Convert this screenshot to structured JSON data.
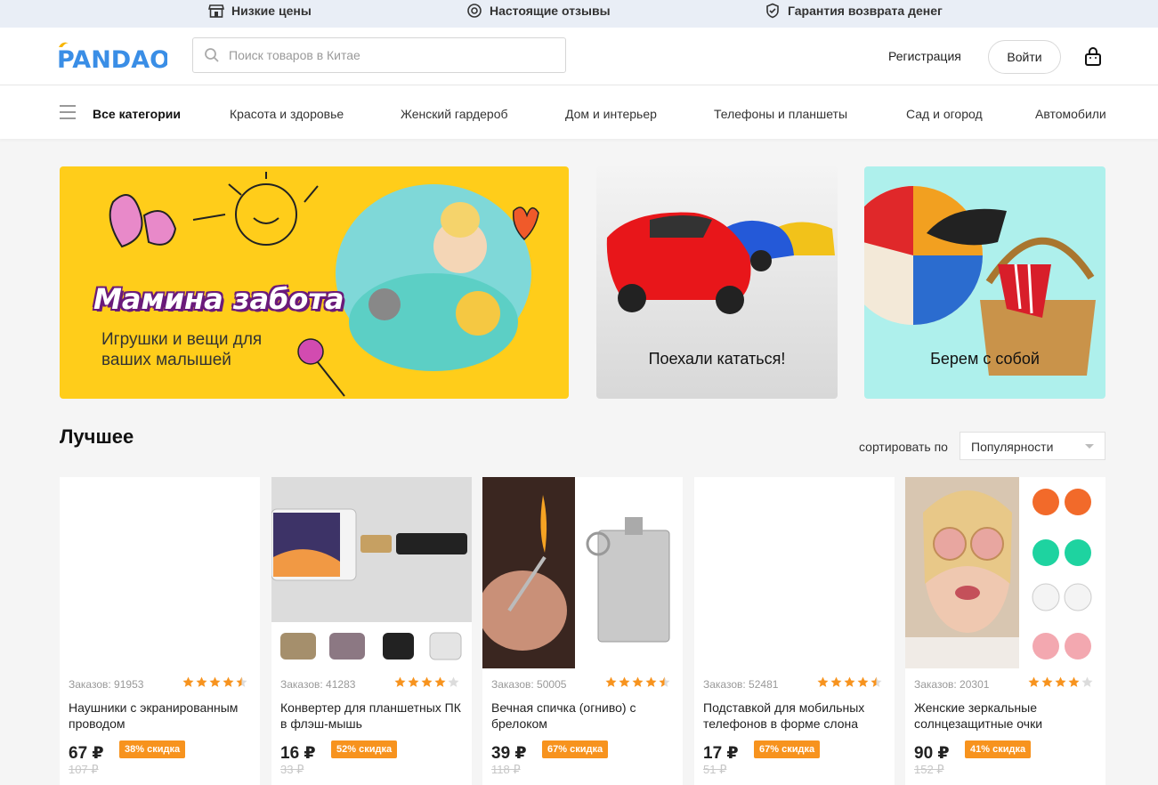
{
  "promo": {
    "items": [
      {
        "label": "Низкие цены",
        "icon": "shop-icon"
      },
      {
        "label": "Настоящие отзывы",
        "icon": "review-icon"
      },
      {
        "label": "Гарантия возврата денег",
        "icon": "shield-icon"
      }
    ]
  },
  "header": {
    "logo": "PANDAO",
    "search_placeholder": "Поиск товаров в Китае",
    "register": "Регистрация",
    "login": "Войти"
  },
  "nav": {
    "all": "Все категории",
    "items": [
      "Красота и здоровье",
      "Женский гардероб",
      "Дом и интерьер",
      "Телефоны и планшеты",
      "Сад и огород",
      "Автомобили"
    ]
  },
  "banners": {
    "main_title": "Мамина забота",
    "main_subtitle": "Игрушки и вещи для ваших малышей",
    "cars_caption": "Поехали кататься!",
    "picnic_caption": "Берем с собой"
  },
  "best": {
    "title": "Лучшее",
    "sort_label": "сортировать по",
    "sort_value": "Популярности"
  },
  "products": [
    {
      "orders": "Заказов: 91953",
      "rating": 4.5,
      "title": "Наушники с экранированным проводом",
      "price": "67 ₽",
      "old": "107 ₽",
      "discount": "38% скидка"
    },
    {
      "orders": "Заказов: 41283",
      "rating": 4.0,
      "title": "Конвертер для планшетных ПК в флэш-мышь",
      "price": "16 ₽",
      "old": "33 ₽",
      "discount": "52% скидка"
    },
    {
      "orders": "Заказов: 50005",
      "rating": 4.5,
      "title": "Вечная спичка (огниво) с брелоком",
      "price": "39 ₽",
      "old": "118 ₽",
      "discount": "67% скидка"
    },
    {
      "orders": "Заказов: 52481",
      "rating": 4.5,
      "title": "Подставкой для мобильных телефонов в форме слона",
      "price": "17 ₽",
      "old": "51 ₽",
      "discount": "67% скидка"
    },
    {
      "orders": "Заказов: 20301",
      "rating": 4.0,
      "title": "Женские зеркальные солнцезащитные очки",
      "price": "90 ₽",
      "old": "152 ₽",
      "discount": "41% скидка"
    }
  ],
  "colors": {
    "accent": "#f7931e",
    "logo_blue": "#3a8ee6",
    "promo_bg": "#e9eef6"
  }
}
